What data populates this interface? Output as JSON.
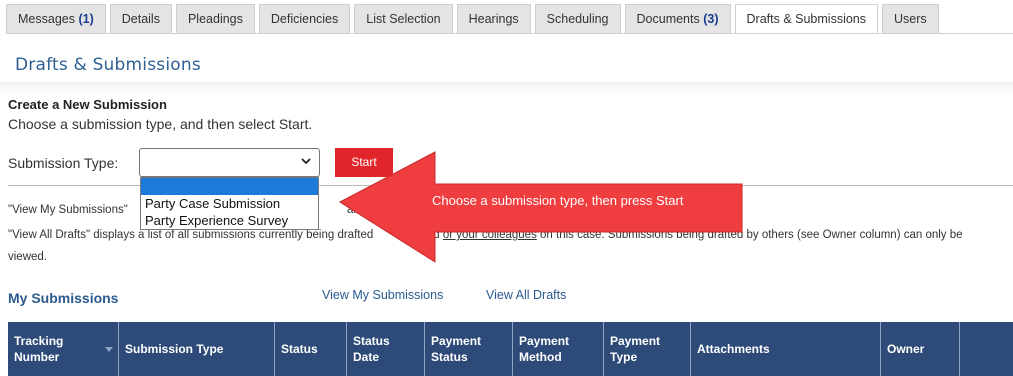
{
  "tabs": [
    {
      "label": "Messages",
      "count": "(1)"
    },
    {
      "label": "Details"
    },
    {
      "label": "Pleadings"
    },
    {
      "label": "Deficiencies"
    },
    {
      "label": "List Selection"
    },
    {
      "label": "Hearings"
    },
    {
      "label": "Scheduling"
    },
    {
      "label": "Documents",
      "count": "(3)"
    },
    {
      "label": "Drafts & Submissions"
    },
    {
      "label": "Users"
    }
  ],
  "section_title": "Drafts & Submissions",
  "create": {
    "title": "Create a New Submission",
    "instructions": "Choose a submission type, and then select Start.",
    "type_label": "Submission Type:",
    "selected_value": "",
    "options": [
      "",
      "Party Case Submission",
      "Party Experience Survey"
    ],
    "start_label": "Start"
  },
  "info": {
    "line1_start": "\"View My Submissions\"",
    "line1_fragment": "are cu",
    "line2_start": "\"View All Drafts\" displays a list of all submissions currently being drafted",
    "line2_mid": "d ",
    "line2_link": "or your colleagues",
    "line2_end": " on this case. Submissions being drafted by others (see Owner column) can only be",
    "line3": "viewed."
  },
  "callout": {
    "text": "Choose a submission type, then press Start",
    "color": "#f03d3f"
  },
  "submissions": {
    "title": "My Submissions",
    "view_my": "View My Submissions",
    "view_all": "View All Drafts",
    "columns": [
      {
        "l1": "Tracking",
        "l2": "Number"
      },
      {
        "l1": "Submission Type",
        "l2": ""
      },
      {
        "l1": "Status",
        "l2": ""
      },
      {
        "l1": "Status",
        "l2": "Date"
      },
      {
        "l1": "Payment",
        "l2": "Status"
      },
      {
        "l1": "Payment",
        "l2": "Method"
      },
      {
        "l1": "Payment",
        "l2": "Type"
      },
      {
        "l1": "Attachments",
        "l2": ""
      },
      {
        "l1": "Owner",
        "l2": ""
      },
      {
        "l1": "",
        "l2": ""
      }
    ]
  },
  "colors": {
    "accent": "#2e5f95",
    "header_bg": "#2d4a78",
    "start_btn": "#e0262a",
    "dropdown_highlight": "#1e7ad8"
  }
}
